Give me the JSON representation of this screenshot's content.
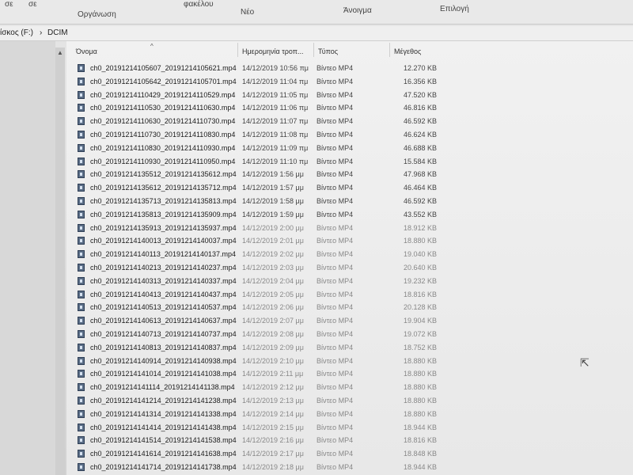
{
  "ribbon": {
    "items": [
      "σε",
      "σε",
      "Οργάνωση",
      "φακέλου",
      "Νέο",
      "Άνοιγμα",
      "Επιλογή"
    ]
  },
  "address": {
    "drive": "ίσκος (F:)",
    "separator": "›",
    "folder": "DCIM"
  },
  "columns": {
    "name": "Όνομα",
    "date": "Ημερομηνία τροπ...",
    "type": "Τύπος",
    "size": "Μέγεθος"
  },
  "files": [
    {
      "name": "ch0_20191214105607_20191214105621.mp4",
      "date": "14/12/2019 10:56 πμ",
      "type": "Βίντεο MP4",
      "size": "12.270 KB"
    },
    {
      "name": "ch0_20191214105642_20191214105701.mp4",
      "date": "14/12/2019 11:04 πμ",
      "type": "Βίντεο MP4",
      "size": "16.356 KB"
    },
    {
      "name": "ch0_20191214110429_20191214110529.mp4",
      "date": "14/12/2019 11:05 πμ",
      "type": "Βίντεο MP4",
      "size": "47.520 KB"
    },
    {
      "name": "ch0_20191214110530_20191214110630.mp4",
      "date": "14/12/2019 11:06 πμ",
      "type": "Βίντεο MP4",
      "size": "46.816 KB"
    },
    {
      "name": "ch0_20191214110630_20191214110730.mp4",
      "date": "14/12/2019 11:07 πμ",
      "type": "Βίντεο MP4",
      "size": "46.592 KB"
    },
    {
      "name": "ch0_20191214110730_20191214110830.mp4",
      "date": "14/12/2019 11:08 πμ",
      "type": "Βίντεο MP4",
      "size": "46.624 KB"
    },
    {
      "name": "ch0_20191214110830_20191214110930.mp4",
      "date": "14/12/2019 11:09 πμ",
      "type": "Βίντεο MP4",
      "size": "46.688 KB"
    },
    {
      "name": "ch0_20191214110930_20191214110950.mp4",
      "date": "14/12/2019 11:10 πμ",
      "type": "Βίντεο MP4",
      "size": "15.584 KB"
    },
    {
      "name": "ch0_20191214135512_20191214135612.mp4",
      "date": "14/12/2019 1:56 μμ",
      "type": "Βίντεο MP4",
      "size": "47.968 KB"
    },
    {
      "name": "ch0_20191214135612_20191214135712.mp4",
      "date": "14/12/2019 1:57 μμ",
      "type": "Βίντεο MP4",
      "size": "46.464 KB"
    },
    {
      "name": "ch0_20191214135713_20191214135813.mp4",
      "date": "14/12/2019 1:58 μμ",
      "type": "Βίντεο MP4",
      "size": "46.592 KB"
    },
    {
      "name": "ch0_20191214135813_20191214135909.mp4",
      "date": "14/12/2019 1:59 μμ",
      "type": "Βίντεο MP4",
      "size": "43.552 KB"
    },
    {
      "name": "ch0_20191214135913_20191214135937.mp4",
      "date": "14/12/2019 2:00 μμ",
      "type": "Βίντεο MP4",
      "size": "18.912 KB"
    },
    {
      "name": "ch0_20191214140013_20191214140037.mp4",
      "date": "14/12/2019 2:01 μμ",
      "type": "Βίντεο MP4",
      "size": "18.880 KB"
    },
    {
      "name": "ch0_20191214140113_20191214140137.mp4",
      "date": "14/12/2019 2:02 μμ",
      "type": "Βίντεο MP4",
      "size": "19.040 KB"
    },
    {
      "name": "ch0_20191214140213_20191214140237.mp4",
      "date": "14/12/2019 2:03 μμ",
      "type": "Βίντεο MP4",
      "size": "20.640 KB"
    },
    {
      "name": "ch0_20191214140313_20191214140337.mp4",
      "date": "14/12/2019 2:04 μμ",
      "type": "Βίντεο MP4",
      "size": "19.232 KB"
    },
    {
      "name": "ch0_20191214140413_20191214140437.mp4",
      "date": "14/12/2019 2:05 μμ",
      "type": "Βίντεο MP4",
      "size": "18.816 KB"
    },
    {
      "name": "ch0_20191214140513_20191214140537.mp4",
      "date": "14/12/2019 2:06 μμ",
      "type": "Βίντεο MP4",
      "size": "20.128 KB"
    },
    {
      "name": "ch0_20191214140613_20191214140637.mp4",
      "date": "14/12/2019 2:07 μμ",
      "type": "Βίντεο MP4",
      "size": "19.904 KB"
    },
    {
      "name": "ch0_20191214140713_20191214140737.mp4",
      "date": "14/12/2019 2:08 μμ",
      "type": "Βίντεο MP4",
      "size": "19.072 KB"
    },
    {
      "name": "ch0_20191214140813_20191214140837.mp4",
      "date": "14/12/2019 2:09 μμ",
      "type": "Βίντεο MP4",
      "size": "18.752 KB"
    },
    {
      "name": "ch0_20191214140914_20191214140938.mp4",
      "date": "14/12/2019 2:10 μμ",
      "type": "Βίντεο MP4",
      "size": "18.880 KB"
    },
    {
      "name": "ch0_20191214141014_20191214141038.mp4",
      "date": "14/12/2019 2:11 μμ",
      "type": "Βίντεο MP4",
      "size": "18.880 KB"
    },
    {
      "name": "ch0_20191214141114_20191214141138.mp4",
      "date": "14/12/2019 2:12 μμ",
      "type": "Βίντεο MP4",
      "size": "18.880 KB"
    },
    {
      "name": "ch0_20191214141214_20191214141238.mp4",
      "date": "14/12/2019 2:13 μμ",
      "type": "Βίντεο MP4",
      "size": "18.880 KB"
    },
    {
      "name": "ch0_20191214141314_20191214141338.mp4",
      "date": "14/12/2019 2:14 μμ",
      "type": "Βίντεο MP4",
      "size": "18.880 KB"
    },
    {
      "name": "ch0_20191214141414_20191214141438.mp4",
      "date": "14/12/2019 2:15 μμ",
      "type": "Βίντεο MP4",
      "size": "18.944 KB"
    },
    {
      "name": "ch0_20191214141514_20191214141538.mp4",
      "date": "14/12/2019 2:16 μμ",
      "type": "Βίντεο MP4",
      "size": "18.816 KB"
    },
    {
      "name": "ch0_20191214141614_20191214141638.mp4",
      "date": "14/12/2019 2:17 μμ",
      "type": "Βίντεο MP4",
      "size": "18.848 KB"
    },
    {
      "name": "ch0_20191214141714_20191214141738.mp4",
      "date": "14/12/2019 2:18 μμ",
      "type": "Βίντεο MP4",
      "size": "18.944 KB"
    }
  ]
}
